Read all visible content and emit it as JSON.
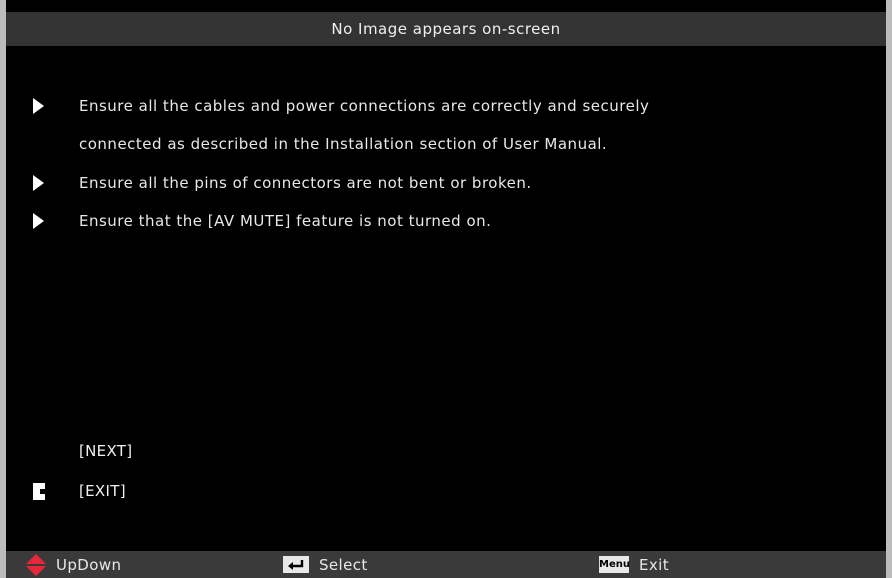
{
  "header": {
    "title": "No Image appears on-screen"
  },
  "tips": [
    {
      "lines": [
        "Ensure all the cables and power connections are correctly and securely",
        "connected as described in the Installation section of User Manual."
      ]
    },
    {
      "lines": [
        "Ensure all the pins of connectors are not bent or broken."
      ]
    },
    {
      "lines": [
        "Ensure that the [AV MUTE] feature is not turned on."
      ]
    }
  ],
  "options": [
    {
      "label": "[NEXT]",
      "selected": false
    },
    {
      "label": "[EXIT]",
      "selected": true
    }
  ],
  "footer": {
    "updown_label": "UpDown",
    "select_label": "Select",
    "menu_key_label": "Menu",
    "exit_label": "Exit"
  },
  "colors": {
    "background": "#000000",
    "title_bar": "#333333",
    "footer_bar": "#3a3a3a",
    "updown_icon": "#e8283a",
    "outer_border": "#bcbcbc"
  }
}
